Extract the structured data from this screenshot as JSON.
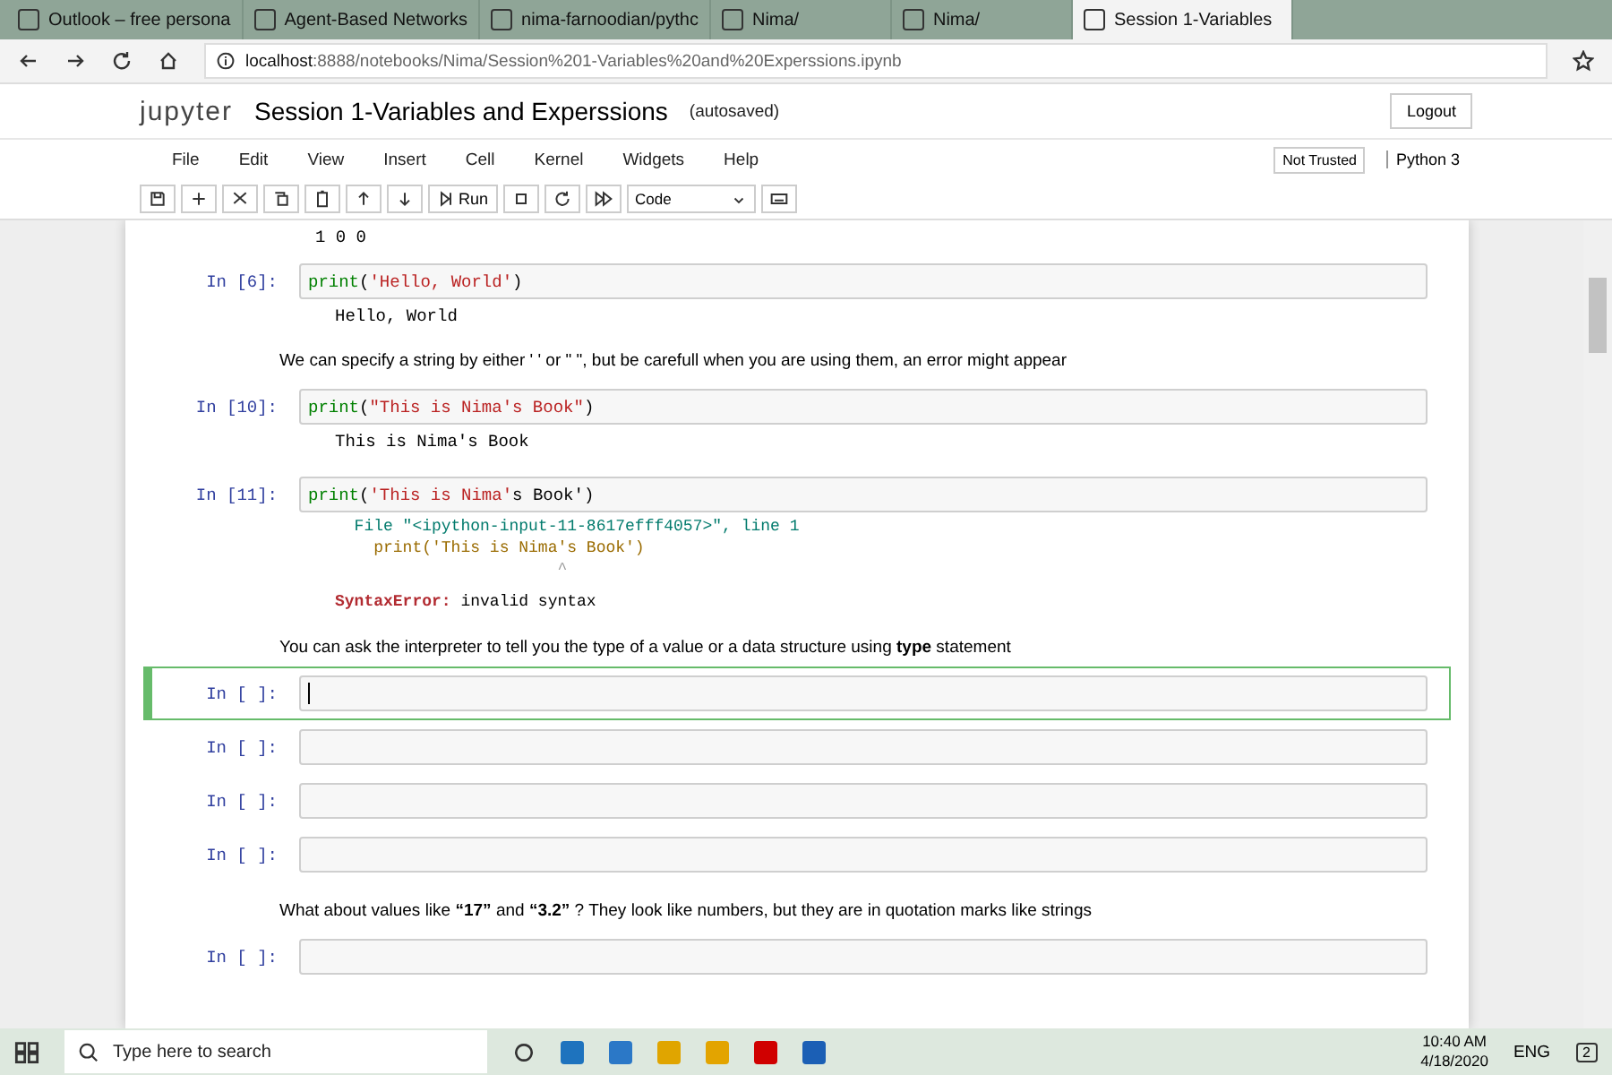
{
  "browser": {
    "tabs": [
      {
        "label": "Outlook – free persona",
        "selected": false
      },
      {
        "label": "Agent-Based Networks",
        "selected": false
      },
      {
        "label": "nima-farnoodian/pythc",
        "selected": false
      },
      {
        "label": "Nima/",
        "selected": false
      },
      {
        "label": "Nima/",
        "selected": false
      },
      {
        "label": "Session 1-Variables",
        "selected": true
      }
    ],
    "url_host": "localhost",
    "url_rest": ":8888/notebooks/Nima/Session%201-Variables%20and%20Experssions.ipynb"
  },
  "jupyter": {
    "logo": "jupyter",
    "title": "Session 1-Variables and Experssions",
    "save_status": "(autosaved)",
    "logout": "Logout",
    "menu": [
      "File",
      "Edit",
      "View",
      "Insert",
      "Cell",
      "Kernel",
      "Widgets",
      "Help"
    ],
    "trust": "Not Trusted",
    "kernel": "Python 3",
    "run_label": "Run",
    "cell_type": "Code"
  },
  "cells": [
    {
      "kind": "output",
      "output": [
        "1 0 0"
      ]
    },
    {
      "kind": "code",
      "prompt": "In [6]:",
      "selected": false,
      "code": [
        {
          "kind": "builtin",
          "text": "print"
        },
        {
          "kind": "plain",
          "text": "("
        },
        {
          "kind": "string",
          "text": "'Hello, World'"
        },
        {
          "kind": "plain",
          "text": ")"
        }
      ],
      "output": [
        "Hello, World"
      ]
    },
    {
      "kind": "markdown",
      "text": "We can specify a string by either ' ' or \" \", but be carefull when you are using them, an error might appear"
    },
    {
      "kind": "code",
      "prompt": "In [10]:",
      "selected": false,
      "code": [
        {
          "kind": "builtin",
          "text": "print"
        },
        {
          "kind": "plain",
          "text": "("
        },
        {
          "kind": "string",
          "text": "\"This is Nima's Book\""
        },
        {
          "kind": "plain",
          "text": ")"
        }
      ],
      "output": [
        "This is Nima's Book"
      ]
    },
    {
      "kind": "code",
      "prompt": "In [11]:",
      "selected": false,
      "code": [
        {
          "kind": "builtin",
          "text": "print"
        },
        {
          "kind": "plain",
          "text": "("
        },
        {
          "kind": "string",
          "text": "'This is Nima'"
        },
        {
          "kind": "plain",
          "text": "s Book')"
        }
      ],
      "error": [
        {
          "kind": "file",
          "text": "  File \"<ipython-input-11-8617efff4057>\", line 1"
        },
        {
          "kind": "source",
          "text": "    print('This is Nima's Book')"
        },
        {
          "kind": "caret",
          "text": "                       ^"
        },
        {
          "kind": "message",
          "name": "SyntaxError:",
          "text": " invalid syntax"
        }
      ]
    },
    {
      "kind": "markdown",
      "text": "You can ask the interpreter to tell you the type of a value or a data structure using **type** statement"
    },
    {
      "kind": "code",
      "prompt": "In [ ]:",
      "selected": true
    },
    {
      "kind": "code",
      "prompt": "In [ ]:",
      "selected": false
    },
    {
      "kind": "code",
      "prompt": "In [ ]:",
      "selected": false
    },
    {
      "kind": "code",
      "prompt": "In [ ]:",
      "selected": false
    },
    {
      "kind": "markdown",
      "text": "What about values like **“17”** and **“3.2”** ? They look like numbers, but they are in quotation marks like strings"
    },
    {
      "kind": "code",
      "prompt": "In [ ]:",
      "selected": false
    }
  ],
  "taskbar": {
    "search_placeholder": "Type here to search",
    "language": "ENG",
    "time": "10:40 AM",
    "date": "4/18/2020",
    "notifications": "2"
  }
}
